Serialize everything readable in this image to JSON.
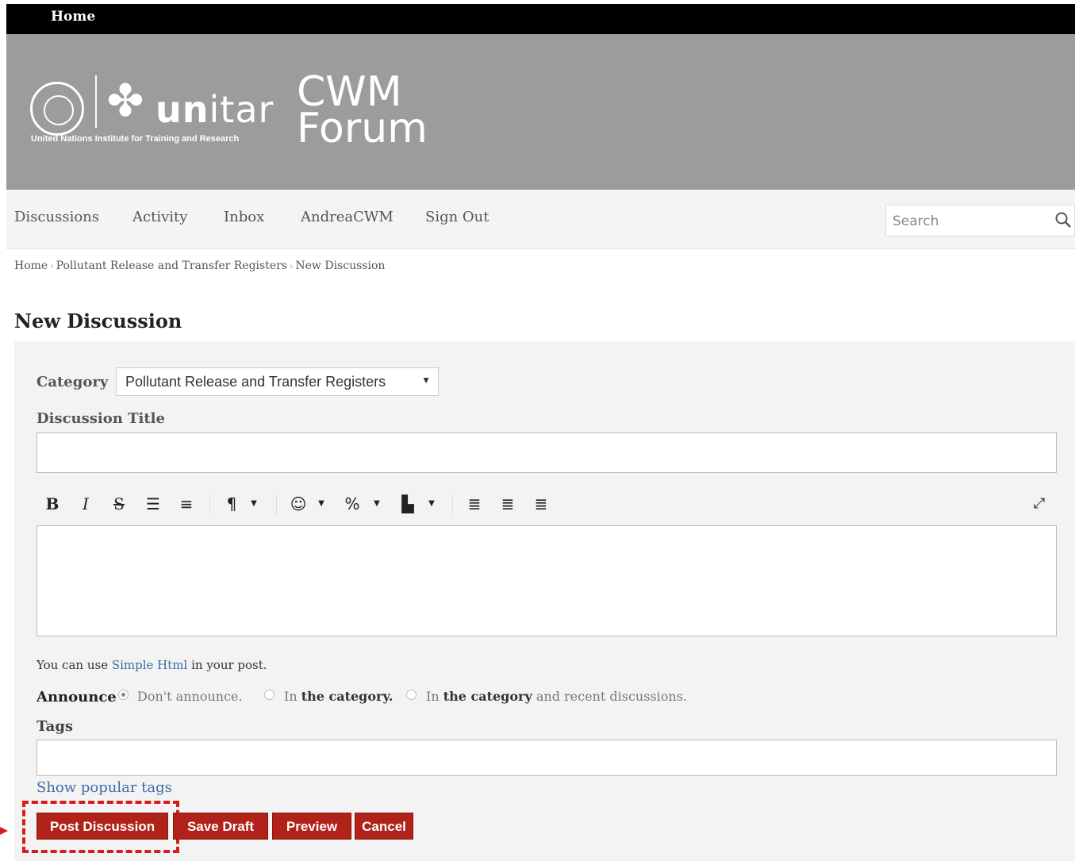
{
  "topbar": {
    "home": "Home"
  },
  "brand": {
    "logo_word": "unitar",
    "logo_word_bold": "un",
    "logo_word_thin": "itar",
    "logo_sub": "United Nations Institute for Training and Research",
    "site_title_line1": "CWM",
    "site_title_line2": "Forum"
  },
  "nav": {
    "items": [
      {
        "label": "Discussions"
      },
      {
        "label": "Activity"
      },
      {
        "label": "Inbox"
      },
      {
        "label": "AndreaCWM"
      },
      {
        "label": "Sign Out"
      }
    ],
    "search_placeholder": "Search"
  },
  "breadcrumb": [
    "Home",
    "Pollutant Release and Transfer Registers",
    "New Discussion"
  ],
  "page_title": "New Discussion",
  "form": {
    "category_label": "Category",
    "category_value": "Pollutant Release and Transfer Registers",
    "title_label": "Discussion Title",
    "title_value": "",
    "body_value": "",
    "hint_prefix": "You can use ",
    "hint_link": "Simple Html",
    "hint_suffix": " in your post.",
    "announce_label": "Announce",
    "announce_options": [
      {
        "text": "Don't announce.",
        "selected": true
      },
      {
        "text_pre": "In ",
        "text_bold": "the category",
        "text_post": ".",
        "selected": false
      },
      {
        "text_pre": "In ",
        "text_bold": "the category",
        "text_post": " and recent discussions.",
        "selected": false
      }
    ],
    "tags_label": "Tags",
    "tags_value": "",
    "popular_tags_link": "Show popular tags",
    "buttons": {
      "post": "Post Discussion",
      "draft": "Save Draft",
      "preview": "Preview",
      "cancel": "Cancel"
    }
  },
  "toolbar": {
    "icons": [
      "bold-icon",
      "italic-icon",
      "strikethrough-icon",
      "ordered-list-icon",
      "bullet-list-icon",
      "paragraph-format-icon",
      "emoji-icon",
      "link-icon",
      "image-icon",
      "align-left-icon",
      "align-center-icon",
      "align-right-icon",
      "fullscreen-icon"
    ]
  },
  "colors": {
    "button": "#b1231a",
    "highlight": "#d81b1b",
    "link": "#3a6ea5",
    "banner": "#9c9c9c"
  }
}
